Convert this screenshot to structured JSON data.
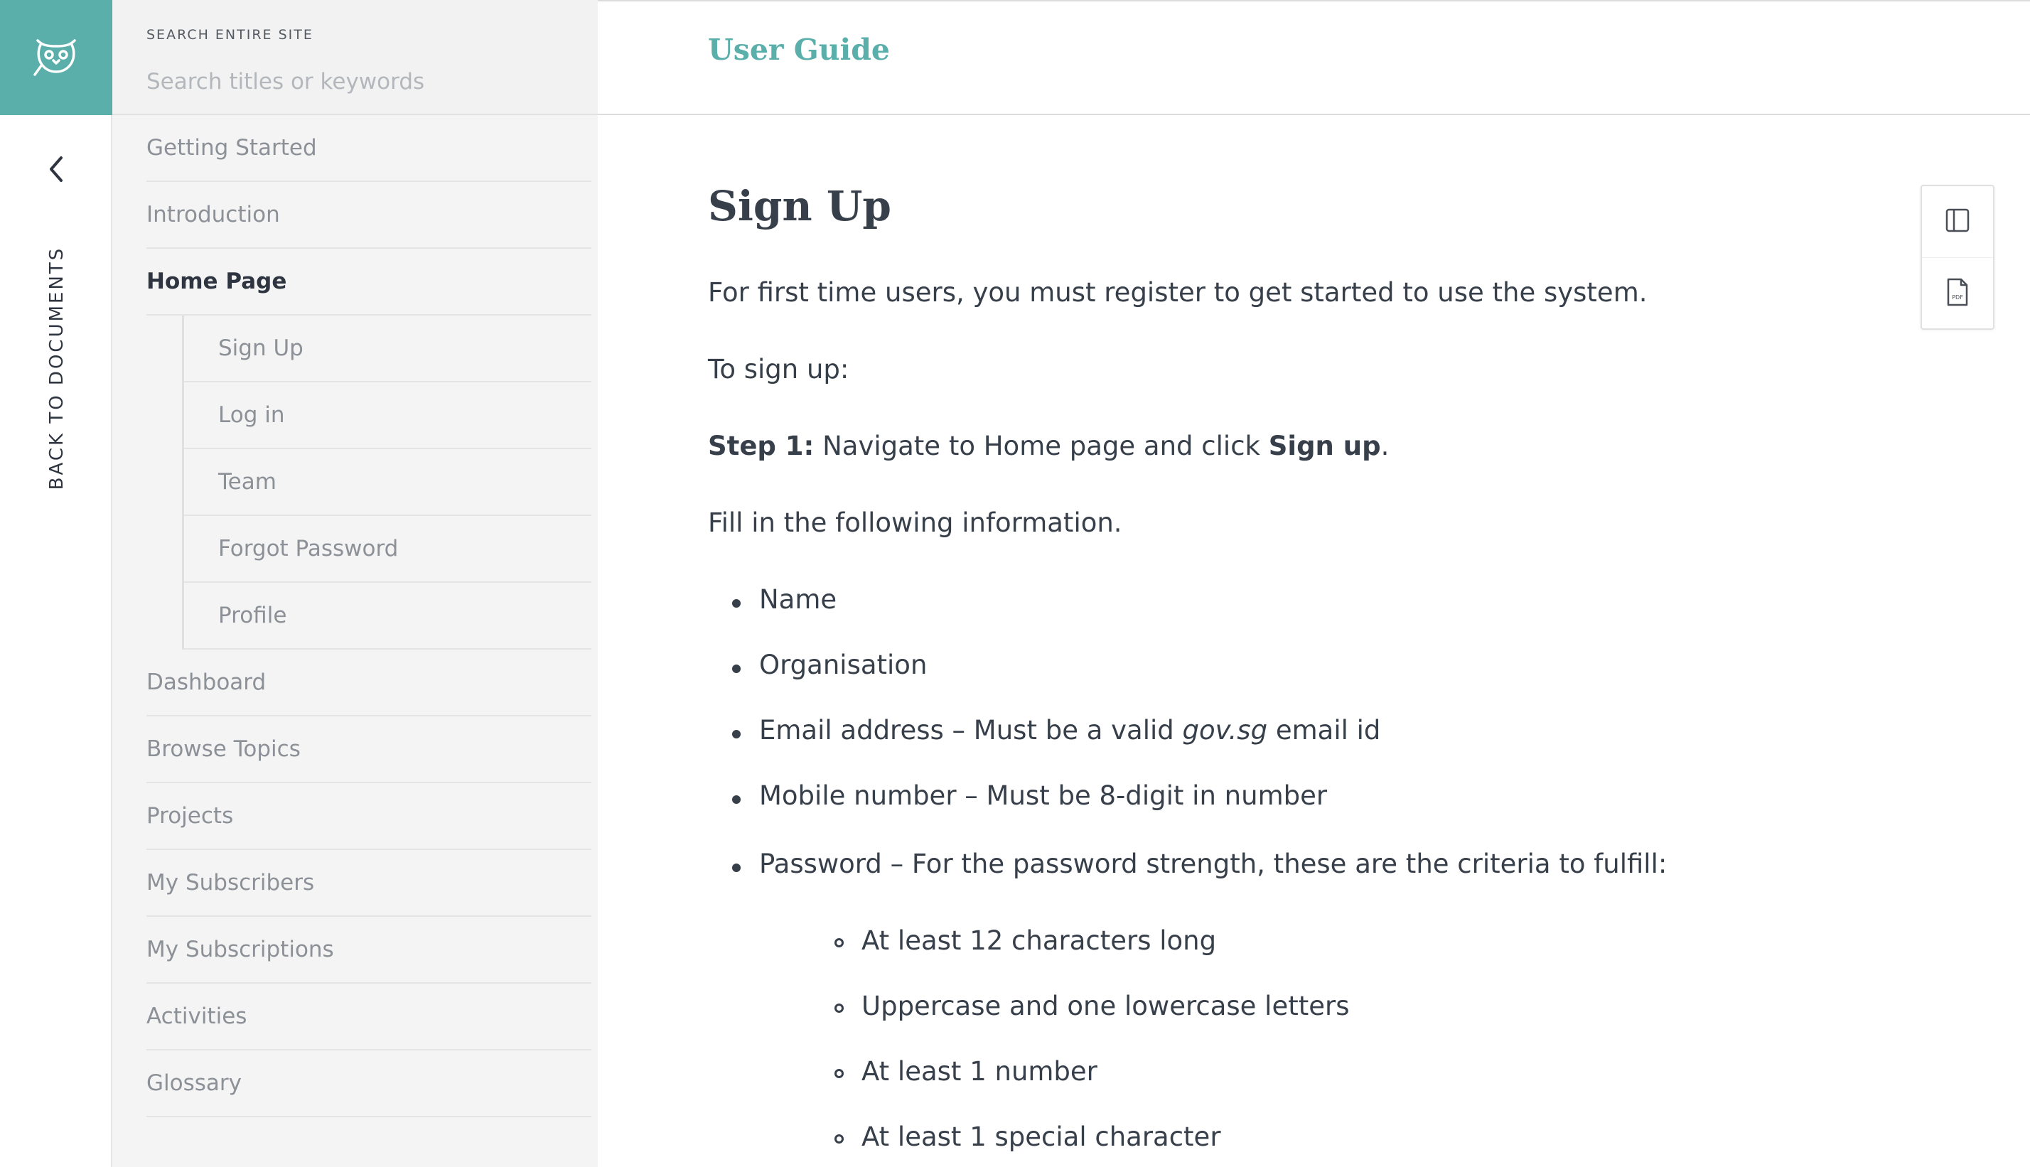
{
  "colors": {
    "brand": "#5aafaa",
    "text": "#373f4a",
    "muted": "#8c9097"
  },
  "rail": {
    "logo_icon": "owl-icon",
    "back_icon": "chevron-left-icon",
    "back_label": "BACK TO DOCUMENTS"
  },
  "search": {
    "caption": "SEARCH ENTIRE SITE",
    "placeholder": "Search titles or keywords"
  },
  "sidebar": {
    "items": [
      {
        "label": "Getting Started"
      },
      {
        "label": "Introduction"
      },
      {
        "label": "Home Page"
      },
      {
        "label": "Dashboard"
      },
      {
        "label": "Browse Topics"
      },
      {
        "label": "Projects"
      },
      {
        "label": "My Subscribers"
      },
      {
        "label": "My Subscriptions"
      },
      {
        "label": "Activities"
      },
      {
        "label": "Glossary"
      }
    ],
    "sub_items": [
      {
        "label": "Sign Up"
      },
      {
        "label": "Log in"
      },
      {
        "label": "Team"
      },
      {
        "label": "Forgot Password"
      },
      {
        "label": "Profile"
      }
    ]
  },
  "header": {
    "title": "User Guide"
  },
  "tools": {
    "sidebar_toggle_icon": "sidebar-panel-icon",
    "pdf_icon": "pdf-file-icon"
  },
  "content": {
    "title": "Sign Up",
    "intro": "For first time users, you must register to get started to use the system.",
    "to_sign_up": "To sign up:",
    "step1_label": "Step 1:",
    "step1_text": " Navigate to Home page and click ",
    "step1_action": "Sign up",
    "step1_end": ".",
    "fill_in": "Fill in the following information.",
    "fields": [
      {
        "text": "Name"
      },
      {
        "text": "Organisation"
      },
      {
        "text": "Email address – Must be a valid ",
        "em": "gov.sg",
        "after": " email id"
      },
      {
        "text": "Mobile number – Must be 8-digit in number"
      },
      {
        "text": "Password – For the password strength, these are the criteria to fulfill:"
      }
    ],
    "password_criteria": [
      "At least 12 characters long",
      "Uppercase and one lowercase letters",
      "At least 1 number",
      "At least 1 special character"
    ]
  }
}
